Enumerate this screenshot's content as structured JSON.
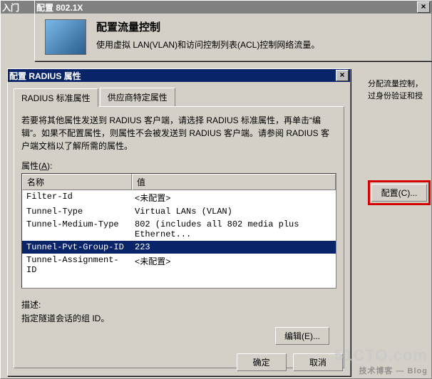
{
  "bg": {
    "title": "入门"
  },
  "tool": {
    "title": "配置 802.1X",
    "heading": "配置流量控制",
    "desc": "使用虚拟 LAN(VLAN)和访问控制列表(ACL)控制网络流量。"
  },
  "side": {
    "note1": "分配流量控制，",
    "note2": "过身份验证和授",
    "config_btn": "配置(C)..."
  },
  "rad": {
    "title": "配置 RADIUS 属性",
    "tabs": {
      "std": "RADIUS 标准属性",
      "vendor": "供应商特定属性"
    },
    "instructions": "若要将其他属性发送到 RADIUS 客户端，请选择 RADIUS 标准属性，再单击“编辑”。如果不配置属性，则属性不会被发送到 RADIUS 客户端。请参阅 RADIUS 客户端文档以了解所需的属性。",
    "attr_label": "属性(A):",
    "col": {
      "name": "名称",
      "value": "值"
    },
    "rows": [
      {
        "name": "Filter-Id",
        "value": "<未配置>"
      },
      {
        "name": "Tunnel-Type",
        "value": "Virtual LANs (VLAN)"
      },
      {
        "name": "Tunnel-Medium-Type",
        "value": "802 (includes all 802 media plus Ethernet..."
      },
      {
        "name": "Tunnel-Pvt-Group-ID",
        "value": "223"
      },
      {
        "name": "Tunnel-Assignment-ID",
        "value": "<未配置>"
      }
    ],
    "desc_label": "描述:",
    "desc_value": "指定隧道会话的组 ID。",
    "edit_btn": "编辑(E)...",
    "ok": "确定",
    "cancel": "取消"
  },
  "watermark": {
    "main": "51CTO.com",
    "sub": "技术博客 — Blog"
  }
}
